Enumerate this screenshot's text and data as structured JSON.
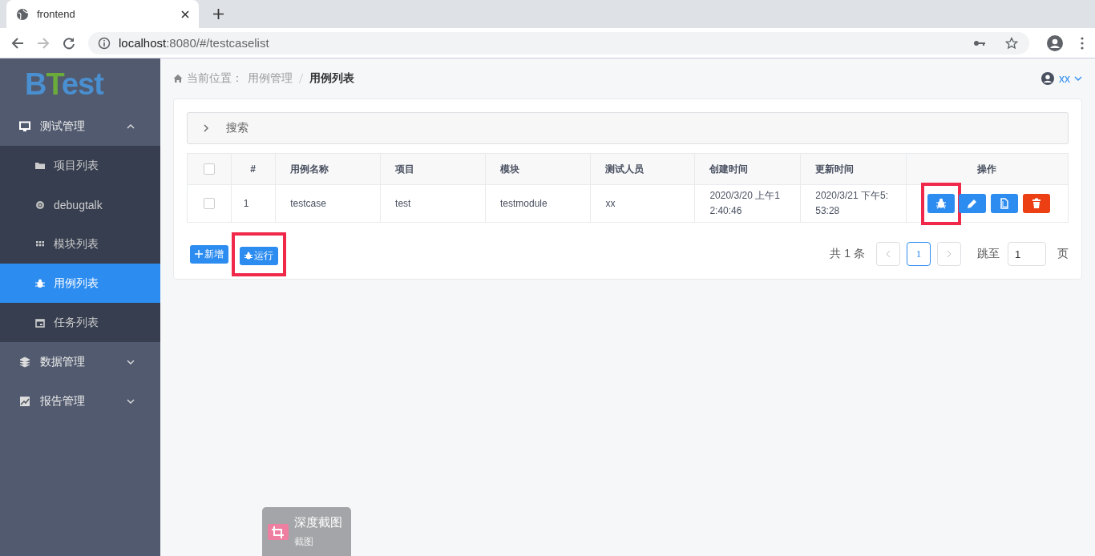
{
  "browser": {
    "tab": {
      "title": "frontend"
    },
    "address": {
      "host": "localhost",
      "path": ":8080/#/testcaselist"
    }
  },
  "logo": {
    "first": "B",
    "accent": "T",
    "rest": "est"
  },
  "sidebar": {
    "menus": [
      {
        "label": "测试管理",
        "kind": "monitor",
        "expanded": true,
        "children": [
          {
            "label": "项目列表",
            "kind": "folder",
            "selected": false
          },
          {
            "label": "debugtalk",
            "kind": "disc",
            "selected": false
          },
          {
            "label": "模块列表",
            "kind": "grid",
            "selected": false
          },
          {
            "label": "用例列表",
            "kind": "bug",
            "selected": true
          },
          {
            "label": "任务列表",
            "kind": "calendar",
            "selected": false
          }
        ]
      },
      {
        "label": "数据管理",
        "kind": "layers",
        "expanded": false
      },
      {
        "label": "报告管理",
        "kind": "chart",
        "expanded": false
      }
    ]
  },
  "breadcrumb": {
    "prefix": "当前位置：",
    "items": [
      {
        "label": "用例管理",
        "current": false
      },
      {
        "label": "用例列表",
        "current": true
      }
    ]
  },
  "user": {
    "name": "xx"
  },
  "search": {
    "label": "搜索",
    "expanded": false
  },
  "table": {
    "all_checked": false,
    "columns": [
      "#",
      "用例名称",
      "项目",
      "模块",
      "测试人员",
      "创建时间",
      "更新时间",
      "操作"
    ],
    "rows": [
      {
        "checked": false,
        "cells": [
          "1",
          "testcase",
          "test",
          "testmodule",
          "xx",
          "2020/3/20 上午12:40:46",
          "2020/3/21 下午5:53:28"
        ],
        "actions": [
          {
            "kind": "run",
            "highlighted": true
          },
          {
            "kind": "edit",
            "highlighted": false
          },
          {
            "kind": "copy",
            "highlighted": false
          },
          {
            "kind": "delete",
            "highlighted": false
          }
        ]
      }
    ]
  },
  "buttons": [
    {
      "kind": "add",
      "label": "新增",
      "highlighted": false
    },
    {
      "kind": "run",
      "label": "运行",
      "highlighted": true
    }
  ],
  "pagination": {
    "total": "共 1 条",
    "pages": [
      {
        "label": "1",
        "selected": true
      }
    ],
    "jump_label": "跳至",
    "jump_value": "1",
    "suffix": "页"
  },
  "notification": {
    "title": "深度截图",
    "subtitle": "截图"
  }
}
